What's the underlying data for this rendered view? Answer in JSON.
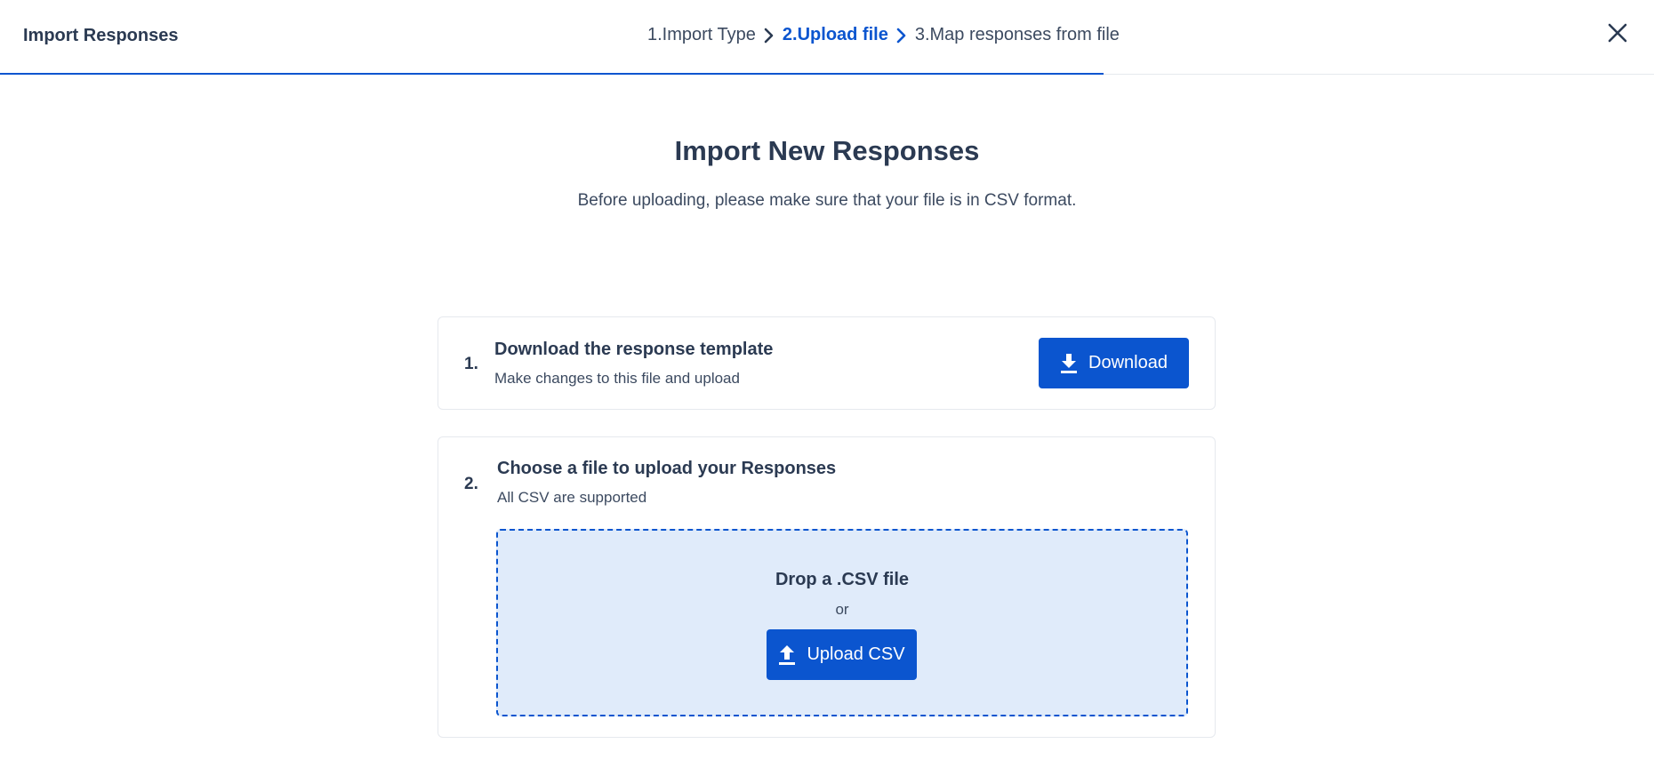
{
  "header": {
    "title": "Import Responses",
    "steps": [
      {
        "label": "1.Import Type",
        "state": "done"
      },
      {
        "label": "2.Upload file",
        "state": "active"
      },
      {
        "label": "3.Map responses from file",
        "state": "pending"
      }
    ],
    "progress_percent": 66.7,
    "close_icon": "close-icon"
  },
  "main": {
    "title": "Import New Responses",
    "subtitle": "Before uploading, please make sure that your file is in CSV format.",
    "card1": {
      "number": "1.",
      "heading": "Download the response template",
      "sub": "Make changes to this file and upload",
      "button_label": "Download",
      "button_icon": "download-icon"
    },
    "card2": {
      "number": "2.",
      "heading": "Choose a file to upload your Responses",
      "sub": "All CSV are supported",
      "drop_title": "Drop a .CSV file",
      "drop_or": "or",
      "button_label": "Upload CSV",
      "button_icon": "upload-icon"
    }
  },
  "colors": {
    "accent": "#0b55cf",
    "dropzone_bg": "#e0ebfa",
    "text": "#2b3a52"
  }
}
